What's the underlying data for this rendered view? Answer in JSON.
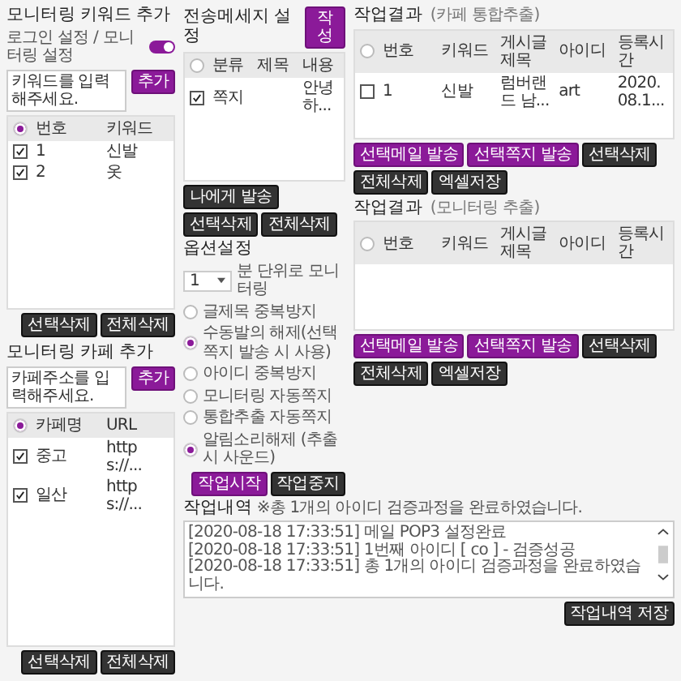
{
  "monitor_panels": [
    {
      "title": "모니터링 키워드 추가",
      "toggle": {
        "label": "로그인 설정 / 모니터링 설정",
        "on": true
      },
      "input": {
        "placeholder": "키워드를 입력해주세요."
      },
      "add_button": "추가",
      "header_selected": true,
      "columns": [
        "번호",
        "키워드"
      ],
      "rows": [
        {
          "checked": true,
          "cells": [
            "1",
            "신발"
          ]
        },
        {
          "checked": true,
          "cells": [
            "2",
            "옷"
          ]
        }
      ],
      "buttons": [
        "선택삭제",
        "전체삭제"
      ]
    },
    {
      "title": "모니터링 카페 추가",
      "input": {
        "placeholder": "카페주소를 입력해주세요."
      },
      "add_button": "추가",
      "header_selected": true,
      "columns": [
        "카페명",
        "URL"
      ],
      "rows": [
        {
          "checked": true,
          "cells": [
            "중고",
            "https://..."
          ]
        },
        {
          "checked": true,
          "cells": [
            "일산",
            "https://..."
          ]
        }
      ],
      "buttons": [
        "선택삭제",
        "전체삭제"
      ]
    }
  ],
  "message_panel": {
    "title": "전송메세지 설정",
    "write_button": "작성",
    "header_selected": false,
    "columns": [
      "분류",
      "제목",
      "내용"
    ],
    "rows": [
      {
        "checked": true,
        "cells": [
          "쪽지",
          null,
          "안녕하..."
        ]
      }
    ],
    "buttons": [
      "나에게 발송",
      "선택삭제",
      "전체삭제"
    ]
  },
  "options": {
    "title": "옵션설정",
    "interval": {
      "value": "1",
      "label": "분 단위로 모니터링"
    },
    "items": [
      {
        "label": "글제목 중복방지",
        "checked": false
      },
      {
        "label": "수동발의 해제(선택쪽지 발송 시 사용)",
        "checked": true
      },
      {
        "label": "아이디 중복방지",
        "checked": false
      },
      {
        "label": "모니터링 자동쪽지",
        "checked": false
      },
      {
        "label": "통합추출 자동쪽지",
        "checked": false
      },
      {
        "label": "알림소리해제 (추출시 사운드)",
        "checked": true
      }
    ],
    "buttons": [
      {
        "label": "작업시작",
        "kind": "primary"
      },
      {
        "label": "작업중지",
        "kind": "dark"
      }
    ]
  },
  "results": [
    {
      "title": "작업결과",
      "subtitle": "(카페 통합추출)",
      "header_selected": false,
      "columns": [
        "번호",
        "키워드",
        "게시글제목",
        "아이디",
        "등록시간"
      ],
      "rows": [
        {
          "checked": false,
          "cells": [
            "1",
            "신발",
            "럼버랜드 남...",
            "art",
            "2020.08.1..."
          ]
        }
      ],
      "buttons": [
        {
          "label": "선택메일 발송",
          "kind": "primary"
        },
        {
          "label": "선택쪽지 발송",
          "kind": "primary"
        },
        {
          "label": "선택삭제",
          "kind": "dark"
        },
        {
          "label": "전체삭제",
          "kind": "dark"
        },
        {
          "label": "엑셀저장",
          "kind": "dark"
        }
      ]
    },
    {
      "title": "작업결과",
      "subtitle": "(모니터링 추출)",
      "header_selected": false,
      "columns": [
        "번호",
        "키워드",
        "게시글제목",
        "아이디",
        "등록시간"
      ],
      "buttons": [
        {
          "label": "선택메일 발송",
          "kind": "primary"
        },
        {
          "label": "선택쪽지 발송",
          "kind": "primary"
        },
        {
          "label": "선택삭제",
          "kind": "dark"
        },
        {
          "label": "전체삭제",
          "kind": "dark"
        },
        {
          "label": "엑셀저장",
          "kind": "dark"
        }
      ]
    }
  ],
  "log": {
    "title": "작업내역",
    "message": "※총 1개의 아이디 검증과정을 완료하였습니다.",
    "lines": [
      "[2020-08-18 17:33:51] 메일 POP3 설정완료",
      "[2020-08-18 17:33:51] 1번째 아이디 [ co ] - 검증성공",
      "[2020-08-18 17:33:51] 총 1개의 아이디 검증과정을 완료하였습니다."
    ],
    "save_button": "작업내역 저장"
  }
}
